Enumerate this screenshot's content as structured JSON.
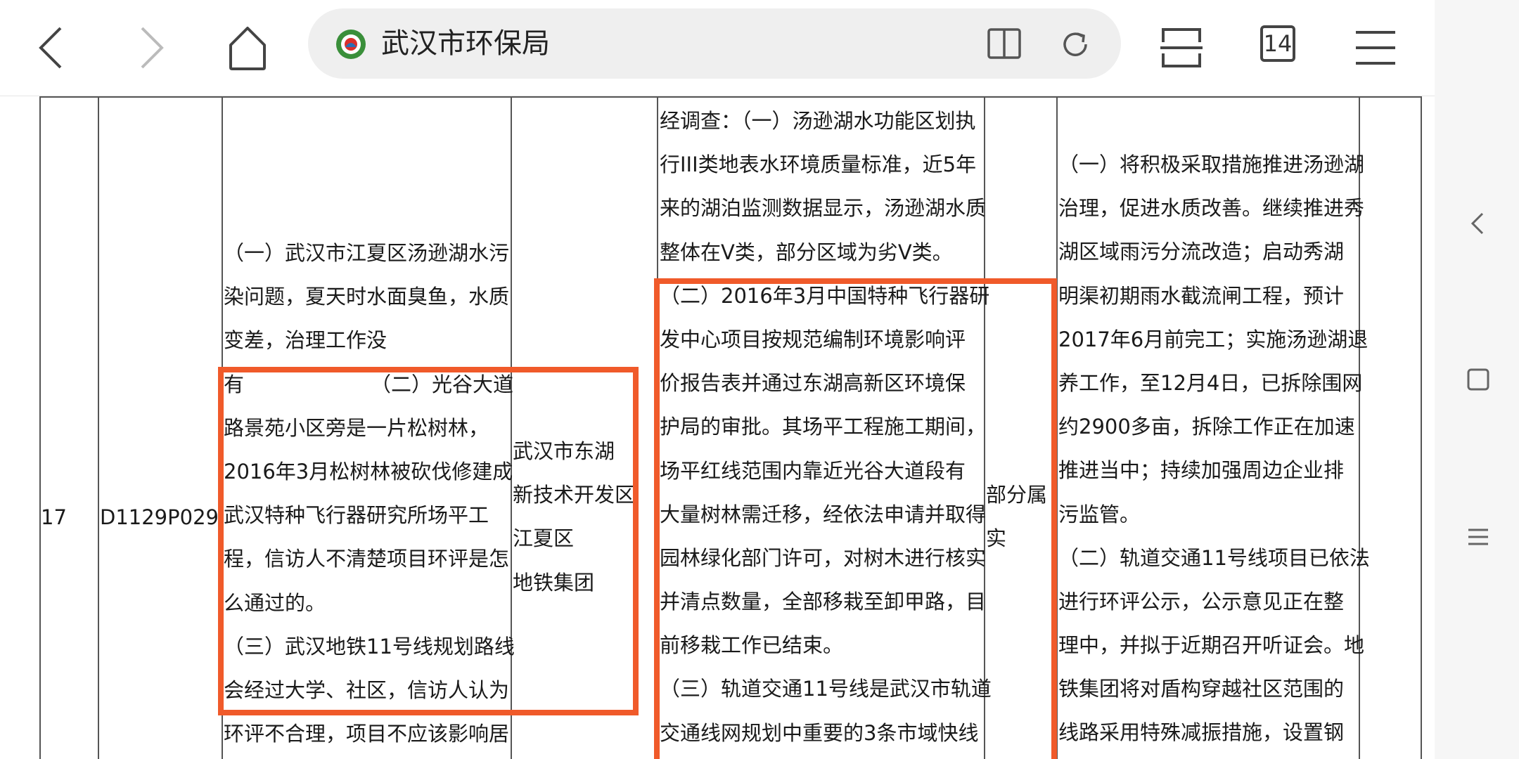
{
  "browser": {
    "site_title": "武汉市环保局",
    "tab_count": "14",
    "icons": {
      "back": "chevron-left-icon",
      "forward": "chevron-right-icon",
      "home": "home-icon",
      "reader": "book-icon",
      "refresh": "refresh-icon",
      "toolbar": "toolbar-toggle-icon",
      "menu": "menu-icon"
    }
  },
  "colors": {
    "highlight": "#f05a2a",
    "table_lines": "#555555",
    "url_bar": "#efefef"
  },
  "table": {
    "row_no": "17",
    "case_id": "D1129P029",
    "complaint_lines": [
      "（一）武汉市江夏区汤逊湖水污",
      "染问题，夏天时水面臭鱼，水质",
      "变差，治理工作没",
      "有",
      "路景苑小区旁是一片松树林，",
      "2016年3月松树林被砍伐修建成",
      "武汉特种飞行器研究所场平工",
      "程，信访人不清楚项目环评是怎",
      "么通过的。",
      "（三）武汉地铁11号线规划路线",
      "会经过大学、社区，信访人认为",
      "环评不合理，项目不应该影响居"
    ],
    "complaint_item2_start": "（二）光谷大道",
    "district_lines": [
      "武汉市东湖",
      "新技术开发区",
      "江夏区",
      "地铁集团"
    ],
    "finding_lines": [
      "经调查：（一）汤逊湖水功能区划执",
      "行III类地表水环境质量标准，近5年",
      "来的湖泊监测数据显示，汤逊湖水质",
      "整体在V类，部分区域为劣V类。",
      "（二）2016年3月中国特种飞行器研",
      "发中心项目按规范编制环境影响评",
      "价报告表并通过东湖高新区环境保",
      "护局的审批。其场平工程施工期间，",
      "场平红线范围内靠近光谷大道段有",
      "大量树林需迁移，经依法申请并取得",
      "园林绿化部门许可，对树木进行核实",
      "并清点数量，全部移栽至卸甲路，目",
      "前移栽工作已结束。",
      "（三）轨道交通11号线是武汉市轨道",
      "交通线网规划中重要的3条市域快线"
    ],
    "verdict_lines": [
      "部分属",
      "实"
    ],
    "action_lines": [
      "（一）将积极采取措施推进汤逊湖",
      "治理，促进水质改善。继续推进秀",
      "湖区域雨污分流改造；启动秀湖",
      "明渠初期雨水截流闸工程，预计",
      "2017年6月前完工；实施汤逊湖退",
      "养工作，至12月4日，已拆除围网",
      "约2900多亩，拆除工作正在加速",
      "推进当中；持续加强周边企业排",
      "污监管。",
      "（二）轨道交通11号线项目已依法",
      "进行环评公示，公示意见正在整",
      "理中，并拟于近期召开听证会。地",
      "铁集团将对盾构穿越社区范围的",
      "线路采用特殊减振措施，设置钢"
    ]
  }
}
